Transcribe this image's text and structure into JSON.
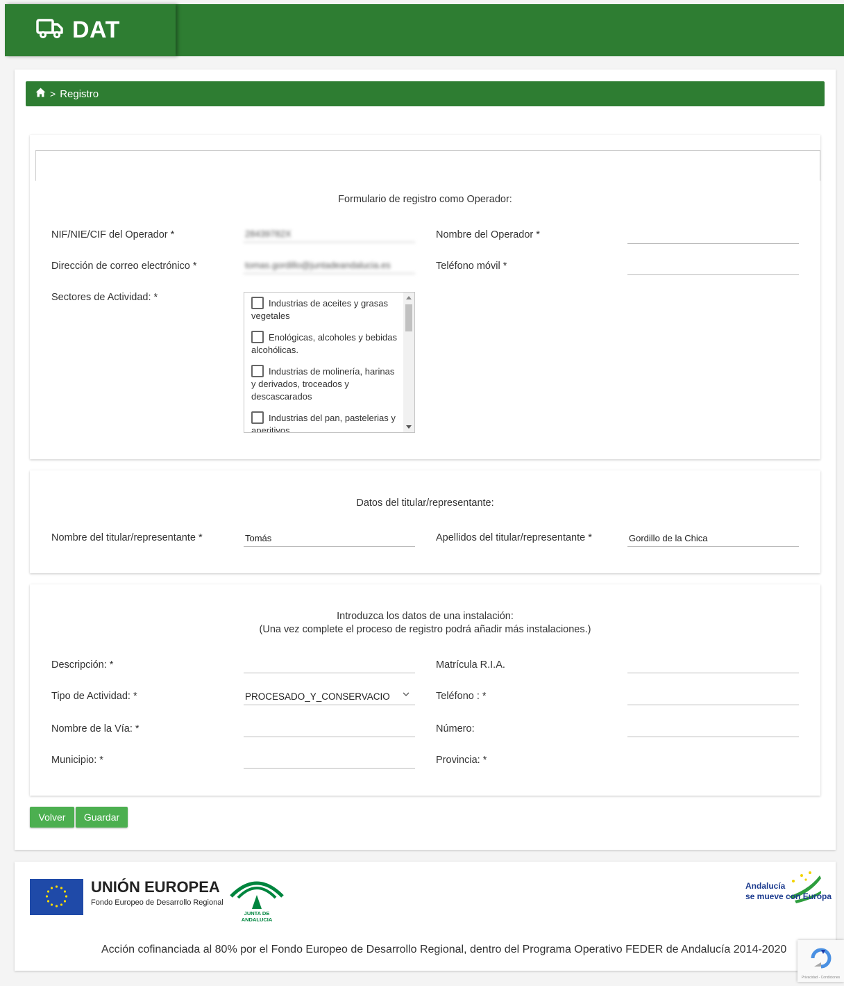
{
  "header": {
    "app_title": "DAT",
    "icon": "truck-icon",
    "color": "#2e7d32"
  },
  "breadcrumb": {
    "home_icon": "home-icon",
    "separator": ">",
    "current": "Registro"
  },
  "operator_section": {
    "title": "Formulario de registro como Operador:",
    "nif_label": "NIF/NIE/CIF del Operador *",
    "nif_value": "28439782X",
    "nombre_label": "Nombre del Operador *",
    "nombre_value": "",
    "email_label": "Dirección de correo electrónico *",
    "email_value": "tomas.gordillo@juntadeandalucia.es",
    "telefono_label": "Teléfono móvil *",
    "telefono_value": "",
    "sectores_label": "Sectores de Actividad: *",
    "sectores": [
      {
        "label": "Industrias de aceites y grasas vegetales",
        "checked": false
      },
      {
        "label": "Enológicas, alcoholes y bebidas alcohólicas.",
        "checked": false
      },
      {
        "label": "Industrias de molinería, harinas y derivados, troceados y descascarados",
        "checked": false
      },
      {
        "label": "Industrias del pan, pastelerias y aperitivos",
        "checked": false
      }
    ]
  },
  "titular_section": {
    "title": "Datos del titular/representante:",
    "nombre_label": "Nombre del titular/representante *",
    "nombre_value": "Tomás",
    "apellidos_label": "Apellidos del titular/representante *",
    "apellidos_value": "Gordillo de la Chica"
  },
  "instalacion_section": {
    "title_line1": "Introduzca los datos de una instalación:",
    "title_line2": "(Una vez complete el proceso de registro podrá añadir más instalaciones.)",
    "descripcion_label": "Descripción: *",
    "descripcion_value": "",
    "matricula_label": "Matrícula R.I.A.",
    "matricula_value": "",
    "tipo_label": "Tipo de Actividad: *",
    "tipo_value": "PROCESADO_Y_CONSERVACIO",
    "telefono_label": "Teléfono : *",
    "telefono_value": "",
    "via_label": "Nombre de la Vía: *",
    "via_value": "",
    "numero_label": "Número:",
    "numero_value": "",
    "municipio_label": "Municipio: *",
    "municipio_value": "",
    "provincia_label": "Provincia: *"
  },
  "buttons": {
    "volver": "Volver",
    "guardar": "Guardar",
    "color": "#4caf50"
  },
  "footer": {
    "eu_title": "UNIÓN EUROPEA",
    "eu_subtitle": "Fondo Europeo de Desarrollo Regional",
    "junta_text": "JUNTA DE ANDALUCIA",
    "andalucia_line1": "Andalucía",
    "andalucia_line2": "se mueve con Europa",
    "note": "Acción cofinanciada al 80% por el Fondo Europeo de Desarrollo Regional, dentro del Programa Operativo FEDER de Andalucía 2014-2020",
    "recaptcha_text": "Privacidad - Condiciones"
  }
}
